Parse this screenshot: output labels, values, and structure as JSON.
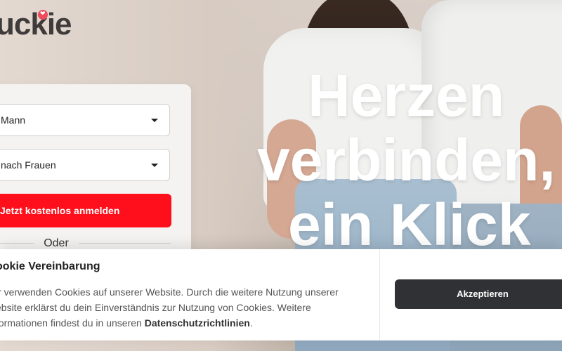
{
  "brand": {
    "logo_text": "uckie",
    "accent_color": "#ef4b5a"
  },
  "hero": {
    "heading_lines": [
      "Herzen",
      "verbinden,",
      "ein Klick"
    ]
  },
  "signup": {
    "gender_select_value": "Mann",
    "seeking_select_value": "nach Frauen",
    "cta_label": "Jetzt kostenlos anmelden",
    "divider_label": "Oder",
    "cta_color": "#ff0f1b"
  },
  "cookie_banner": {
    "title": "ookie Vereinbarung",
    "text_prefix": "ir verwenden Cookies auf unserer Website. Durch die weitere Nutzung unserer ebsite erklärst du dein Einverständnis zur Nutzung von Cookies. Weitere formationen findest du in unseren ",
    "privacy_link": "Datenschutzrichtlinien",
    "text_suffix": ".",
    "accept_label": "Akzeptieren",
    "accept_color": "#2f3135"
  }
}
